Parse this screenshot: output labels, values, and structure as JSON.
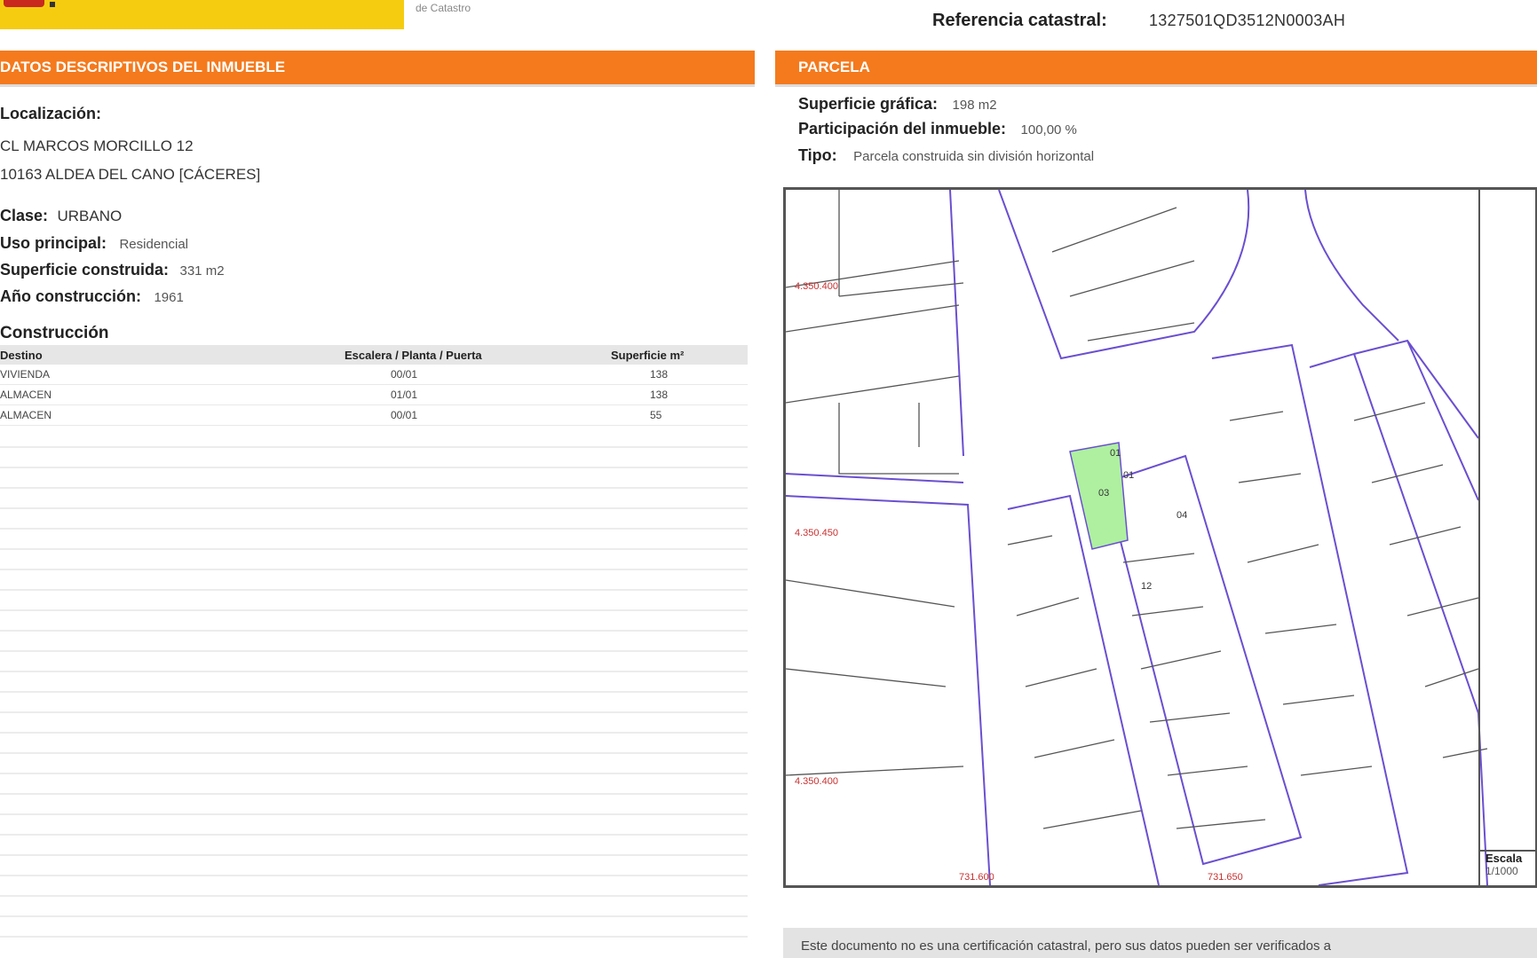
{
  "header": {
    "sede_text": "de Catastro",
    "ref_label": "Referencia catastral:",
    "ref_value": "1327501QD3512N0003AH"
  },
  "left": {
    "section_title": "DATOS DESCRIPTIVOS DEL INMUEBLE",
    "localizacion_label": "Localización:",
    "address_line1": "CL MARCOS MORCILLO 12",
    "address_line2": "10163 ALDEA DEL CANO [CÁCERES]",
    "clase_label": "Clase:",
    "clase_value": "URBANO",
    "uso_label": "Uso principal:",
    "uso_value": "Residencial",
    "superficie_label": "Superficie construida:",
    "superficie_value": "331 m2",
    "anio_label": "Año construcción:",
    "anio_value": "1961",
    "construccion_label": "Construcción",
    "table": {
      "headers": [
        "Destino",
        "Escalera / Planta / Puerta",
        "Superficie m²"
      ],
      "rows": [
        [
          "VIVIENDA",
          "00/01",
          "138"
        ],
        [
          "ALMACEN",
          "01/01",
          "138"
        ],
        [
          "ALMACEN",
          "00/01",
          "55"
        ]
      ]
    }
  },
  "right": {
    "section_title": "PARCELA",
    "sup_label": "Superficie gráfica:",
    "sup_value": "198 m2",
    "part_label": "Participación del inmueble:",
    "part_value": "100,00 %",
    "tipo_label": "Tipo:",
    "tipo_value": "Parcela construida sin división horizontal",
    "map": {
      "coord_labels": [
        "4.350.400",
        "4.350.450",
        "4.350.400",
        "731.600",
        "731.650"
      ],
      "parcel_numbers": [
        "03",
        "01",
        "04",
        "12",
        "01"
      ],
      "highlight_color": "#aef0a0",
      "line_color": "#6a4fd0"
    },
    "scale_label": "Escala",
    "scale_value": "1/1000",
    "footer_text": "Este documento no es una certificación catastral, pero sus datos pueden ser verificados a"
  },
  "colors": {
    "orange": "#f47a1d",
    "yellow": "#f6cc10"
  }
}
